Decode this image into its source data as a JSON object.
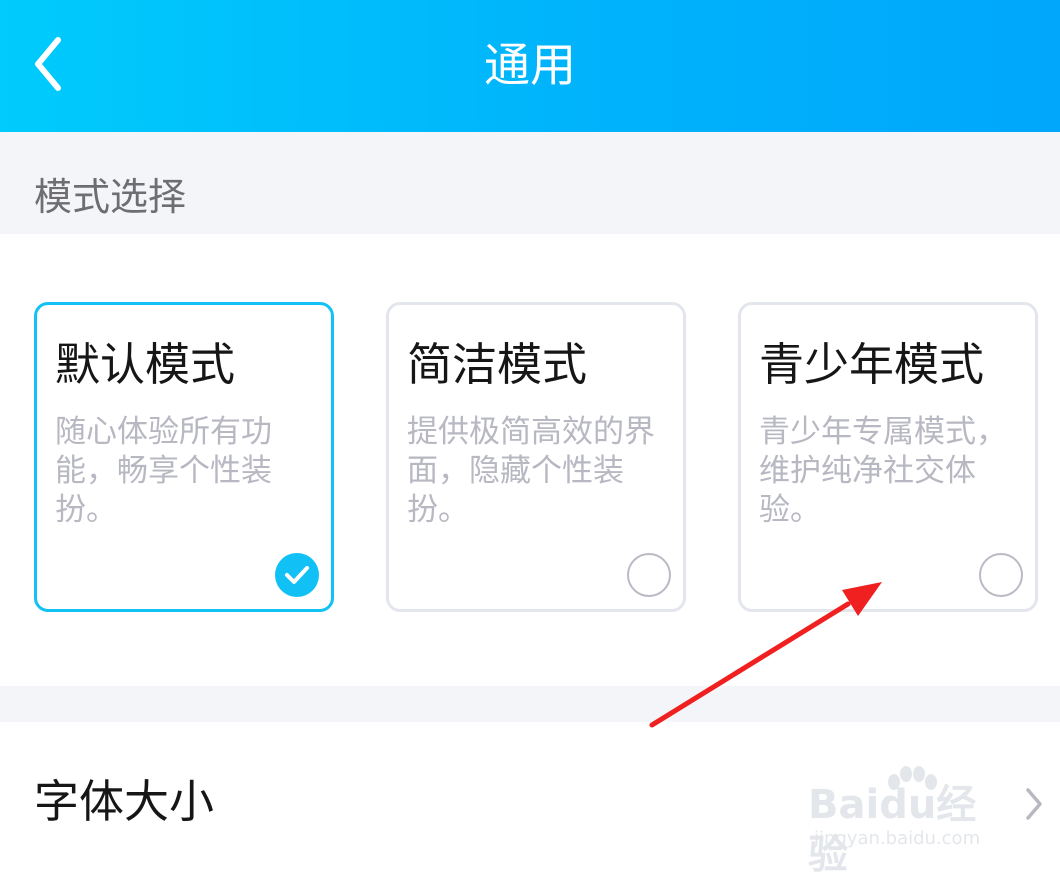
{
  "header": {
    "title": "通用",
    "back_icon": "chevron-left-icon"
  },
  "section": {
    "label": "模式选择"
  },
  "modes": [
    {
      "title": "默认模式",
      "description": "随心体验所有功能，畅享个性装扮。",
      "selected": true
    },
    {
      "title": "简洁模式",
      "description": "提供极简高效的界面，隐藏个性装扮。",
      "selected": false
    },
    {
      "title": "青少年模式",
      "description": "青少年专属模式，维护纯净社交体验。",
      "selected": false
    }
  ],
  "font_size_row": {
    "label": "字体大小",
    "icon": "chevron-right-icon"
  },
  "watermark": {
    "logo": "Baidu经验",
    "url": "jingyan.baidu.com"
  },
  "annotation": {
    "icon": "red-arrow-icon",
    "color": "#f02020"
  },
  "colors": {
    "header_gradient_start": "#00cbfc",
    "header_gradient_end": "#00a7fb",
    "accent": "#12c2f4",
    "background": "#f4f5f9"
  }
}
